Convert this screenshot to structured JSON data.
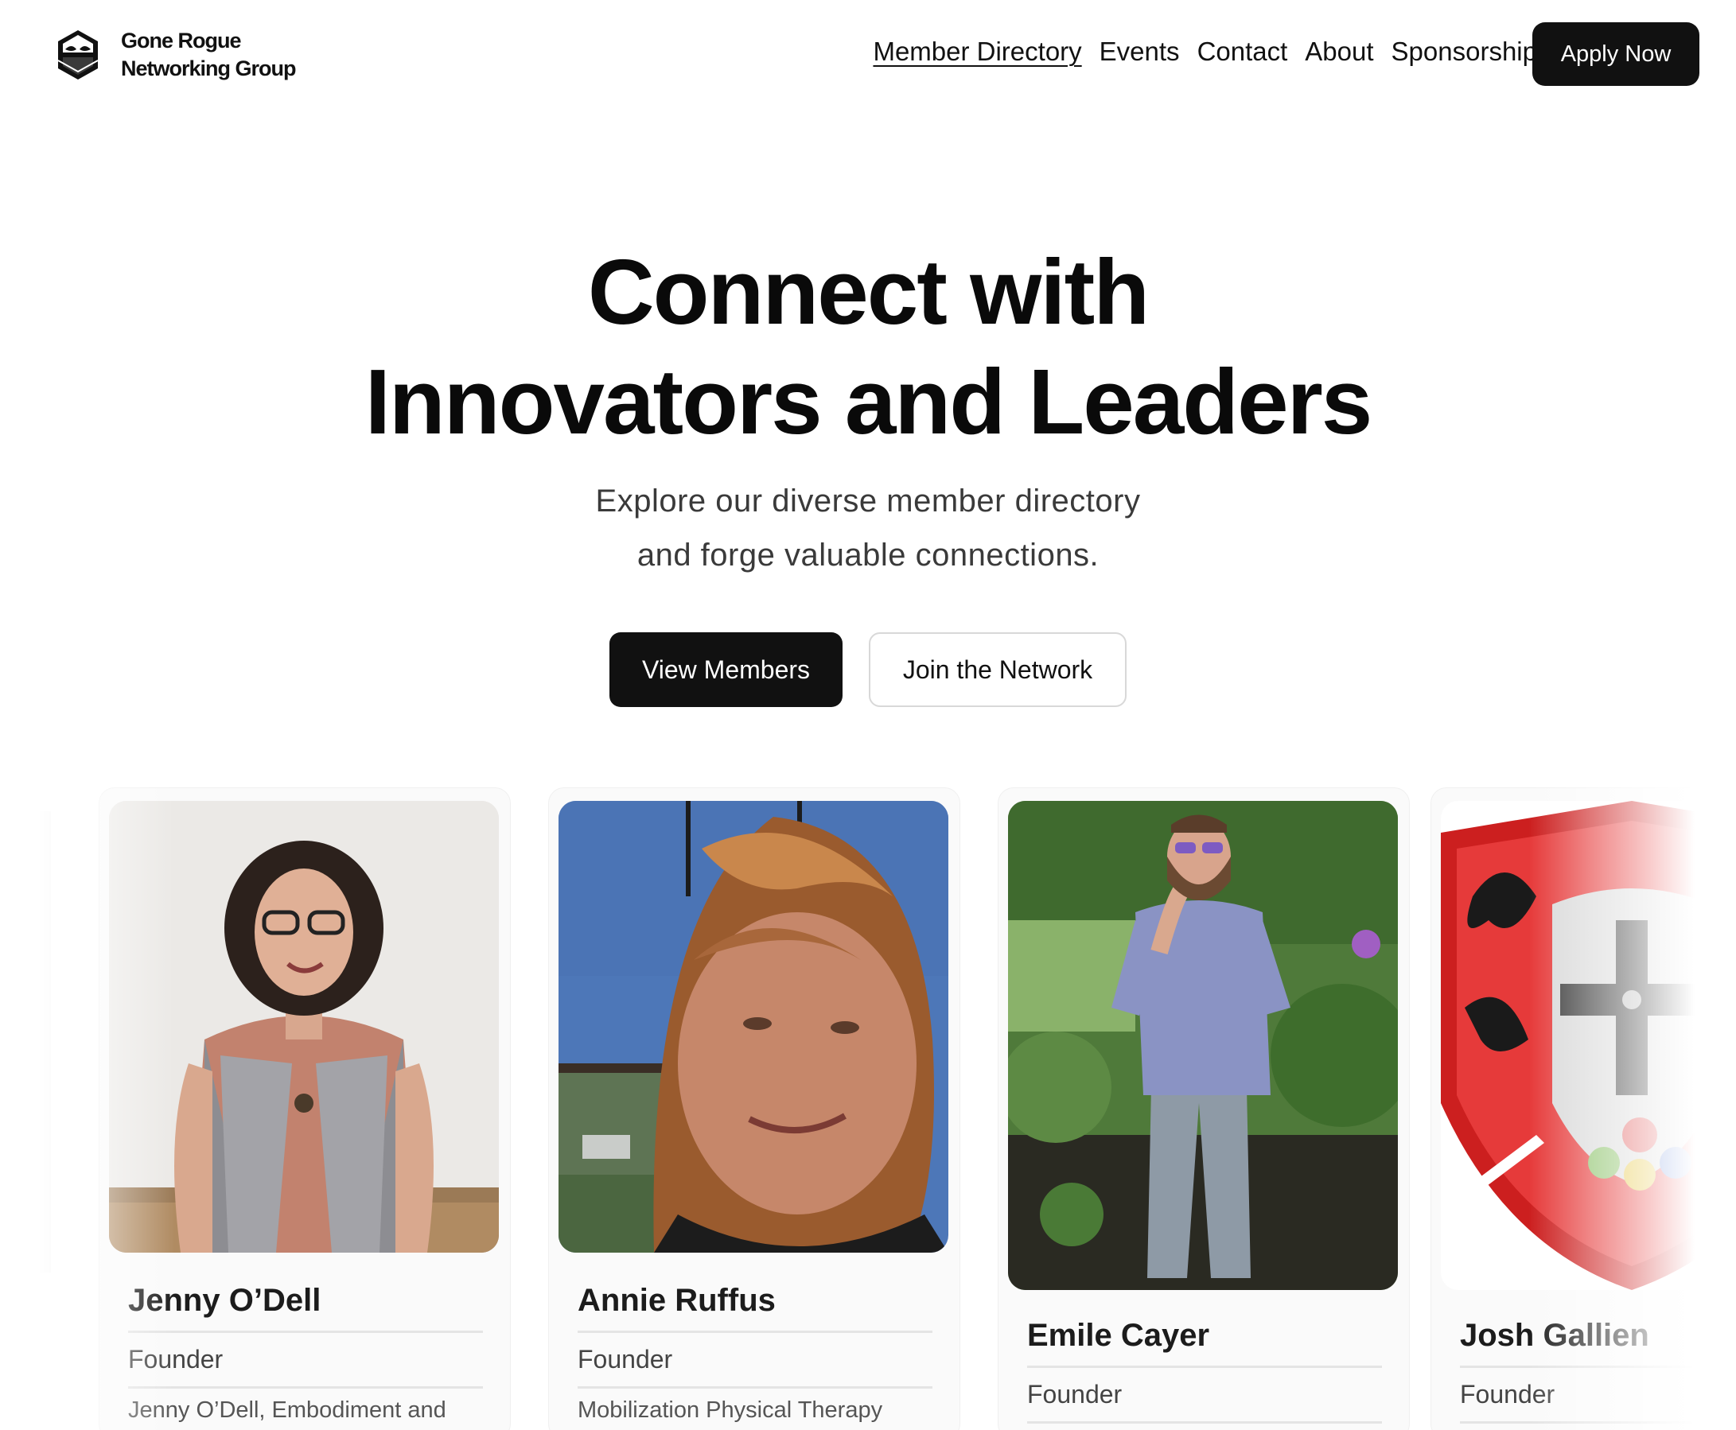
{
  "brand": {
    "line1": "Gone Rogue",
    "line2": "Networking Group"
  },
  "nav": {
    "items": [
      "Member Directory",
      "Events",
      "Contact",
      "About",
      "Sponsorship"
    ],
    "active": "Member Directory",
    "apply_label": "Apply Now"
  },
  "hero": {
    "title_line1": "Connect with",
    "title_line2": "Innovators and Leaders",
    "subtitle_line1": "Explore our diverse member directory",
    "subtitle_line2": "and forge valuable connections.",
    "primary_label": "View Members",
    "secondary_label": "Join the Network"
  },
  "members": [
    {
      "name": "Jenny O’Dell",
      "role": "Founder",
      "description": "Jenny O’Dell, Embodiment and"
    },
    {
      "name": "Annie Ruffus",
      "role": "Founder",
      "description": "Mobilization Physical Therapy"
    },
    {
      "name": "Emile Cayer",
      "role": "Founder",
      "description": ""
    },
    {
      "name": "Josh Gallien",
      "role": "Founder",
      "description": ""
    }
  ],
  "colors": {
    "primary": "#111111",
    "accent_shield": "#d62828"
  }
}
